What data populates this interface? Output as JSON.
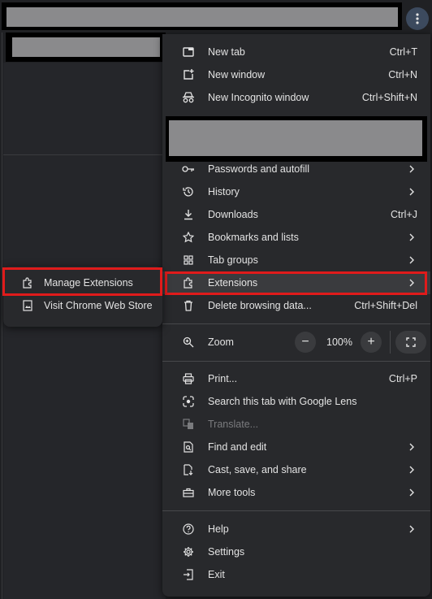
{
  "menu": {
    "new_tab": {
      "label": "New tab",
      "shortcut": "Ctrl+T"
    },
    "new_window": {
      "label": "New window",
      "shortcut": "Ctrl+N"
    },
    "incognito": {
      "label": "New Incognito window",
      "shortcut": "Ctrl+Shift+N"
    },
    "passwords": {
      "label": "Passwords and autofill"
    },
    "history": {
      "label": "History"
    },
    "downloads": {
      "label": "Downloads",
      "shortcut": "Ctrl+J"
    },
    "bookmarks": {
      "label": "Bookmarks and lists"
    },
    "tab_groups": {
      "label": "Tab groups"
    },
    "extensions": {
      "label": "Extensions"
    },
    "delete_data": {
      "label": "Delete browsing data...",
      "shortcut": "Ctrl+Shift+Del"
    },
    "zoom": {
      "label": "Zoom",
      "value": "100%",
      "minus": "−",
      "plus": "+"
    },
    "print": {
      "label": "Print...",
      "shortcut": "Ctrl+P"
    },
    "lens": {
      "label": "Search this tab with Google Lens"
    },
    "translate": {
      "label": "Translate..."
    },
    "find_edit": {
      "label": "Find and edit"
    },
    "cast": {
      "label": "Cast, save, and share"
    },
    "more_tools": {
      "label": "More tools"
    },
    "help": {
      "label": "Help"
    },
    "settings": {
      "label": "Settings"
    },
    "exit": {
      "label": "Exit"
    }
  },
  "extensions_submenu": {
    "manage": {
      "label": "Manage Extensions"
    },
    "webstore": {
      "label": "Visit Chrome Web Store"
    }
  },
  "colors": {
    "highlight": "#e01b1b",
    "menu_bg": "#28292c",
    "redaction": "#8a8a8c"
  }
}
